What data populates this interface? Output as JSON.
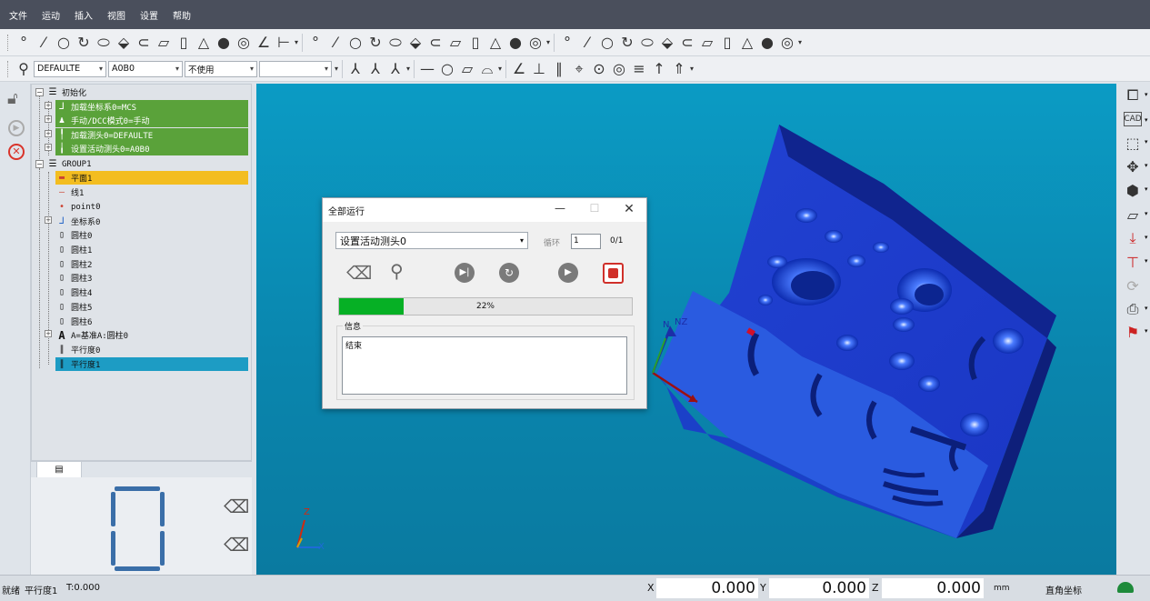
{
  "menu": [
    "文件",
    "运动",
    "插入",
    "视图",
    "设置",
    "帮助"
  ],
  "toolbar": {
    "row1_icons": [
      "point-icon",
      "line-icon",
      "circle-icon",
      "arc-icon",
      "ellipse-icon",
      "plane-icon",
      "slot-icon",
      "rect-icon",
      "cylinder-icon",
      "cone-icon",
      "sphere-icon",
      "torus-icon",
      "angle-icon",
      "distance-icon"
    ],
    "probe_combo": "DEFAULTE",
    "tip_combo": "A0B0",
    "mode_combo": "不使用",
    "blank_combo": ""
  },
  "tree": {
    "root1": "初始化",
    "init_items": [
      "加载坐标系0=MCS",
      "手动/DCC模式0=手动",
      "加载测头0=DEFAULTE",
      "设置活动测头0=A0B0"
    ],
    "root2": "GROUP1",
    "group_items": [
      "平面1",
      "线1",
      "point0",
      "坐标系0",
      "圆柱0",
      "圆柱1",
      "圆柱2",
      "圆柱3",
      "圆柱4",
      "圆柱5",
      "圆柱6",
      "A=基准A:圆柱0",
      "平行度0",
      "平行度1"
    ]
  },
  "segment_display": "0",
  "dialog": {
    "title": "全部运行",
    "current_step": "设置活动测头0",
    "loop_label": "循环",
    "loop_value": "1",
    "loop_count": "0/1",
    "progress_percent": 22,
    "progress_text": "22%",
    "info_label": "信息",
    "info_text": "结束"
  },
  "viewport": {
    "triad_labels": [
      "Z",
      "X"
    ],
    "part_triad_labels": [
      "N",
      "NZ"
    ]
  },
  "status": {
    "ready": "就绪",
    "current": "平行度1",
    "tolerance": "T:0.000",
    "x_label": "X",
    "x_value": "0.000",
    "y_label": "Y",
    "y_value": "0.000",
    "z_label": "Z",
    "z_value": "0.000",
    "unit": "mm",
    "coord_mode": "直角坐标"
  }
}
